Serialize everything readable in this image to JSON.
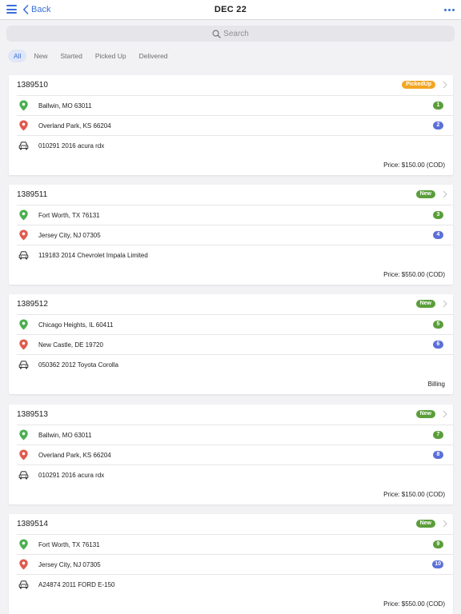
{
  "nav": {
    "back_label": "Back",
    "title": "DEC 22"
  },
  "search": {
    "placeholder": "Search"
  },
  "filters": [
    "All",
    "New",
    "Started",
    "Picked Up",
    "Delivered"
  ],
  "colors": {
    "accent": "#3a6fd8",
    "status_pickedup": "#f2a623",
    "status_new": "#5a9e3a",
    "pickup_pin": "#4caf50",
    "delivery_pin": "#e05a4f",
    "delivery_number": "#5b6fd8"
  },
  "icons": [
    "menu-icon",
    "chevron-left-icon",
    "more-icon",
    "search-icon",
    "pickup-pin-icon",
    "delivery-pin-icon",
    "car-icon",
    "chevron-right-icon"
  ],
  "orders": [
    {
      "id": "1389510",
      "status": "PickedUp",
      "pickup": "Ballwin, MO 63011",
      "pickup_no": "1",
      "delivery": "Overland Park, KS 66204",
      "delivery_no": "2",
      "vehicle": "010291 2016 acura rdx",
      "footer": "Price: $150.00 (COD)"
    },
    {
      "id": "1389511",
      "status": "New",
      "pickup": "Fort Worth, TX 76131",
      "pickup_no": "3",
      "delivery": "Jersey City, NJ 07305",
      "delivery_no": "4",
      "vehicle": "119183 2014 Chevrolet Impala Limited",
      "footer": "Price: $550.00 (COD)"
    },
    {
      "id": "1389512",
      "status": "New",
      "pickup": "Chicago Heights, IL 60411",
      "pickup_no": "5",
      "delivery": "New Castle, DE 19720",
      "delivery_no": "6",
      "vehicle": "050362 2012 Toyota Corolla",
      "footer": "Billing"
    },
    {
      "id": "1389513",
      "status": "New",
      "pickup": "Ballwin, MO 63011",
      "pickup_no": "7",
      "delivery": "Overland Park, KS 66204",
      "delivery_no": "8",
      "vehicle": "010291 2016 acura rdx",
      "footer": "Price: $150.00 (COD)"
    },
    {
      "id": "1389514",
      "status": "New",
      "pickup": "Fort Worth, TX 76131",
      "pickup_no": "9",
      "delivery": "Jersey City, NJ 07305",
      "delivery_no": "10",
      "vehicle": "A24874 2011 FORD E-150",
      "footer": "Price: $550.00 (COD)"
    }
  ]
}
